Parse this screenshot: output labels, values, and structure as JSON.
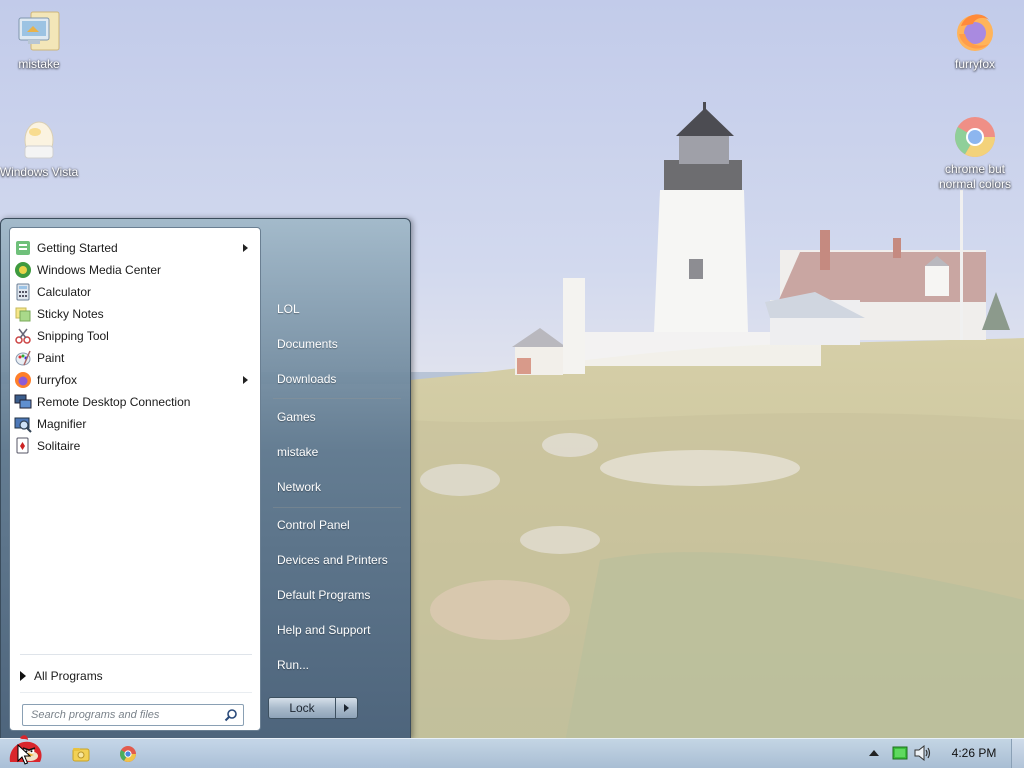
{
  "desktop": {
    "icons": [
      {
        "label": "mistake",
        "icon": "computer-folder-icon"
      },
      {
        "label": "Windows Vista",
        "icon": "egg-icon"
      },
      {
        "label": "furryfox",
        "icon": "firefox-icon"
      },
      {
        "label": "chrome but normal colors",
        "icon": "chrome-icon"
      }
    ]
  },
  "start_menu": {
    "programs": [
      {
        "label": "Getting Started",
        "icon": "getting-started-icon",
        "has_submenu": true
      },
      {
        "label": "Windows Media Center",
        "icon": "media-center-icon",
        "has_submenu": false
      },
      {
        "label": "Calculator",
        "icon": "calculator-icon",
        "has_submenu": false
      },
      {
        "label": "Sticky Notes",
        "icon": "sticky-notes-icon",
        "has_submenu": false
      },
      {
        "label": "Snipping Tool",
        "icon": "scissors-icon",
        "has_submenu": false
      },
      {
        "label": "Paint",
        "icon": "paint-palette-icon",
        "has_submenu": false
      },
      {
        "label": "furryfox",
        "icon": "firefox-icon",
        "has_submenu": true
      },
      {
        "label": "Remote Desktop Connection",
        "icon": "remote-desktop-icon",
        "has_submenu": false
      },
      {
        "label": "Magnifier",
        "icon": "magnifier-icon",
        "has_submenu": false
      },
      {
        "label": "Solitaire",
        "icon": "cards-icon",
        "has_submenu": false
      }
    ],
    "all_programs_label": "All Programs",
    "search_placeholder": "Search programs and files",
    "right_items": [
      {
        "label": "LOL"
      },
      {
        "label": "Documents"
      },
      {
        "label": "Downloads"
      },
      {
        "label": "Games"
      },
      {
        "label": "mistake"
      },
      {
        "label": "Network"
      },
      {
        "label": "Control Panel"
      },
      {
        "label": "Devices and Printers"
      },
      {
        "label": "Default Programs"
      },
      {
        "label": "Help and Support"
      },
      {
        "label": "Run..."
      }
    ],
    "shutdown_label": "Lock"
  },
  "taskbar": {
    "pinned": [
      {
        "icon": "explorer-folder-icon"
      },
      {
        "icon": "chrome-icon"
      }
    ],
    "tray_icons": [
      "show-hidden-icons-arrow",
      "network-icon",
      "volume-icon"
    ],
    "clock": "4:26 PM"
  },
  "colors": {
    "menu_frame": "#5c768c",
    "taskbar": "#b4c8dc",
    "sky": "#c9d3ea"
  }
}
